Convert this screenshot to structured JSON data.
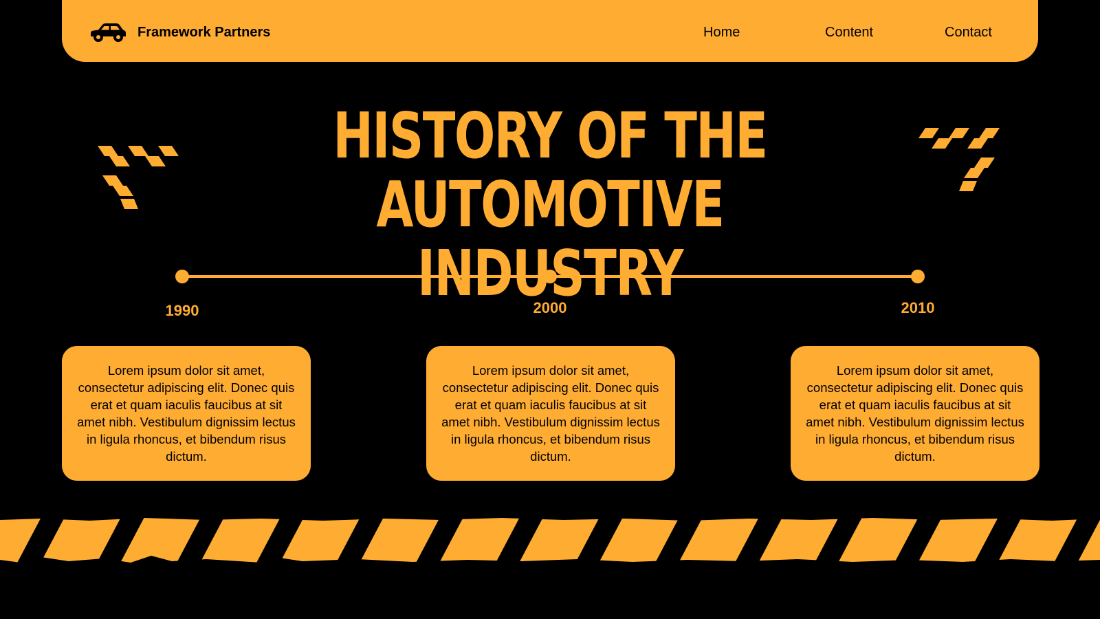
{
  "colors": {
    "accent": "#FFAC33",
    "background": "#000000",
    "text_dark": "#000000"
  },
  "nav": {
    "brand_icon": "car-icon",
    "brand_name": "Framework Partners",
    "links": [
      "Home",
      "Content",
      "Contact"
    ]
  },
  "title": {
    "line1": "HISTORY OF THE",
    "line2": "AUTOMOTIVE INDUSTRY"
  },
  "decorations": {
    "checker_icon": "checkered-flag-icon",
    "stripe_icon": "hazard-stripe-tape"
  },
  "timeline": {
    "years": [
      "1990",
      "2000",
      "2010"
    ],
    "cards": [
      "Lorem ipsum dolor sit amet, consectetur adipiscing elit. Donec quis erat et quam iaculis faucibus at sit amet nibh. Vestibulum dignissim lectus in ligula rhoncus, et bibendum risus dictum.",
      "Lorem ipsum dolor sit amet, consectetur adipiscing elit. Donec quis erat et quam iaculis faucibus at sit amet nibh. Vestibulum dignissim lectus in ligula rhoncus, et bibendum risus dictum.",
      "Lorem ipsum dolor sit amet, consectetur adipiscing elit. Donec quis erat et quam iaculis faucibus at sit amet nibh. Vestibulum dignissim lectus in ligula rhoncus, et bibendum risus dictum."
    ]
  }
}
